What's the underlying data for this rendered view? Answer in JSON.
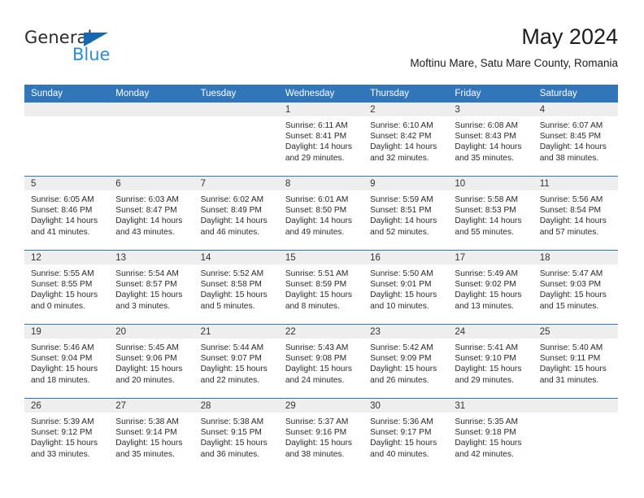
{
  "brand": {
    "name_part1": "General",
    "name_part2": "Blue",
    "triangle_color": "#1668b3",
    "blue_color": "#2e8bd4"
  },
  "header": {
    "title": "May 2024",
    "location": "Moftinu Mare, Satu Mare County, Romania"
  },
  "theme": {
    "header_blue": "#3176b9",
    "daynum_band": "#eeeeee",
    "text": "#2a2a2a"
  },
  "calendar": {
    "weekday_headers": [
      "Sunday",
      "Monday",
      "Tuesday",
      "Wednesday",
      "Thursday",
      "Friday",
      "Saturday"
    ],
    "weeks": [
      [
        {
          "empty": true
        },
        {
          "empty": true
        },
        {
          "empty": true
        },
        {
          "day": "1",
          "sunrise": "Sunrise: 6:11 AM",
          "sunset": "Sunset: 8:41 PM",
          "daylight1": "Daylight: 14 hours",
          "daylight2": "and 29 minutes."
        },
        {
          "day": "2",
          "sunrise": "Sunrise: 6:10 AM",
          "sunset": "Sunset: 8:42 PM",
          "daylight1": "Daylight: 14 hours",
          "daylight2": "and 32 minutes."
        },
        {
          "day": "3",
          "sunrise": "Sunrise: 6:08 AM",
          "sunset": "Sunset: 8:43 PM",
          "daylight1": "Daylight: 14 hours",
          "daylight2": "and 35 minutes."
        },
        {
          "day": "4",
          "sunrise": "Sunrise: 6:07 AM",
          "sunset": "Sunset: 8:45 PM",
          "daylight1": "Daylight: 14 hours",
          "daylight2": "and 38 minutes."
        }
      ],
      [
        {
          "day": "5",
          "sunrise": "Sunrise: 6:05 AM",
          "sunset": "Sunset: 8:46 PM",
          "daylight1": "Daylight: 14 hours",
          "daylight2": "and 41 minutes."
        },
        {
          "day": "6",
          "sunrise": "Sunrise: 6:03 AM",
          "sunset": "Sunset: 8:47 PM",
          "daylight1": "Daylight: 14 hours",
          "daylight2": "and 43 minutes."
        },
        {
          "day": "7",
          "sunrise": "Sunrise: 6:02 AM",
          "sunset": "Sunset: 8:49 PM",
          "daylight1": "Daylight: 14 hours",
          "daylight2": "and 46 minutes."
        },
        {
          "day": "8",
          "sunrise": "Sunrise: 6:01 AM",
          "sunset": "Sunset: 8:50 PM",
          "daylight1": "Daylight: 14 hours",
          "daylight2": "and 49 minutes."
        },
        {
          "day": "9",
          "sunrise": "Sunrise: 5:59 AM",
          "sunset": "Sunset: 8:51 PM",
          "daylight1": "Daylight: 14 hours",
          "daylight2": "and 52 minutes."
        },
        {
          "day": "10",
          "sunrise": "Sunrise: 5:58 AM",
          "sunset": "Sunset: 8:53 PM",
          "daylight1": "Daylight: 14 hours",
          "daylight2": "and 55 minutes."
        },
        {
          "day": "11",
          "sunrise": "Sunrise: 5:56 AM",
          "sunset": "Sunset: 8:54 PM",
          "daylight1": "Daylight: 14 hours",
          "daylight2": "and 57 minutes."
        }
      ],
      [
        {
          "day": "12",
          "sunrise": "Sunrise: 5:55 AM",
          "sunset": "Sunset: 8:55 PM",
          "daylight1": "Daylight: 15 hours",
          "daylight2": "and 0 minutes."
        },
        {
          "day": "13",
          "sunrise": "Sunrise: 5:54 AM",
          "sunset": "Sunset: 8:57 PM",
          "daylight1": "Daylight: 15 hours",
          "daylight2": "and 3 minutes."
        },
        {
          "day": "14",
          "sunrise": "Sunrise: 5:52 AM",
          "sunset": "Sunset: 8:58 PM",
          "daylight1": "Daylight: 15 hours",
          "daylight2": "and 5 minutes."
        },
        {
          "day": "15",
          "sunrise": "Sunrise: 5:51 AM",
          "sunset": "Sunset: 8:59 PM",
          "daylight1": "Daylight: 15 hours",
          "daylight2": "and 8 minutes."
        },
        {
          "day": "16",
          "sunrise": "Sunrise: 5:50 AM",
          "sunset": "Sunset: 9:01 PM",
          "daylight1": "Daylight: 15 hours",
          "daylight2": "and 10 minutes."
        },
        {
          "day": "17",
          "sunrise": "Sunrise: 5:49 AM",
          "sunset": "Sunset: 9:02 PM",
          "daylight1": "Daylight: 15 hours",
          "daylight2": "and 13 minutes."
        },
        {
          "day": "18",
          "sunrise": "Sunrise: 5:47 AM",
          "sunset": "Sunset: 9:03 PM",
          "daylight1": "Daylight: 15 hours",
          "daylight2": "and 15 minutes."
        }
      ],
      [
        {
          "day": "19",
          "sunrise": "Sunrise: 5:46 AM",
          "sunset": "Sunset: 9:04 PM",
          "daylight1": "Daylight: 15 hours",
          "daylight2": "and 18 minutes."
        },
        {
          "day": "20",
          "sunrise": "Sunrise: 5:45 AM",
          "sunset": "Sunset: 9:06 PM",
          "daylight1": "Daylight: 15 hours",
          "daylight2": "and 20 minutes."
        },
        {
          "day": "21",
          "sunrise": "Sunrise: 5:44 AM",
          "sunset": "Sunset: 9:07 PM",
          "daylight1": "Daylight: 15 hours",
          "daylight2": "and 22 minutes."
        },
        {
          "day": "22",
          "sunrise": "Sunrise: 5:43 AM",
          "sunset": "Sunset: 9:08 PM",
          "daylight1": "Daylight: 15 hours",
          "daylight2": "and 24 minutes."
        },
        {
          "day": "23",
          "sunrise": "Sunrise: 5:42 AM",
          "sunset": "Sunset: 9:09 PM",
          "daylight1": "Daylight: 15 hours",
          "daylight2": "and 26 minutes."
        },
        {
          "day": "24",
          "sunrise": "Sunrise: 5:41 AM",
          "sunset": "Sunset: 9:10 PM",
          "daylight1": "Daylight: 15 hours",
          "daylight2": "and 29 minutes."
        },
        {
          "day": "25",
          "sunrise": "Sunrise: 5:40 AM",
          "sunset": "Sunset: 9:11 PM",
          "daylight1": "Daylight: 15 hours",
          "daylight2": "and 31 minutes."
        }
      ],
      [
        {
          "day": "26",
          "sunrise": "Sunrise: 5:39 AM",
          "sunset": "Sunset: 9:12 PM",
          "daylight1": "Daylight: 15 hours",
          "daylight2": "and 33 minutes."
        },
        {
          "day": "27",
          "sunrise": "Sunrise: 5:38 AM",
          "sunset": "Sunset: 9:14 PM",
          "daylight1": "Daylight: 15 hours",
          "daylight2": "and 35 minutes."
        },
        {
          "day": "28",
          "sunrise": "Sunrise: 5:38 AM",
          "sunset": "Sunset: 9:15 PM",
          "daylight1": "Daylight: 15 hours",
          "daylight2": "and 36 minutes."
        },
        {
          "day": "29",
          "sunrise": "Sunrise: 5:37 AM",
          "sunset": "Sunset: 9:16 PM",
          "daylight1": "Daylight: 15 hours",
          "daylight2": "and 38 minutes."
        },
        {
          "day": "30",
          "sunrise": "Sunrise: 5:36 AM",
          "sunset": "Sunset: 9:17 PM",
          "daylight1": "Daylight: 15 hours",
          "daylight2": "and 40 minutes."
        },
        {
          "day": "31",
          "sunrise": "Sunrise: 5:35 AM",
          "sunset": "Sunset: 9:18 PM",
          "daylight1": "Daylight: 15 hours",
          "daylight2": "and 42 minutes."
        },
        {
          "empty": true
        }
      ]
    ]
  }
}
